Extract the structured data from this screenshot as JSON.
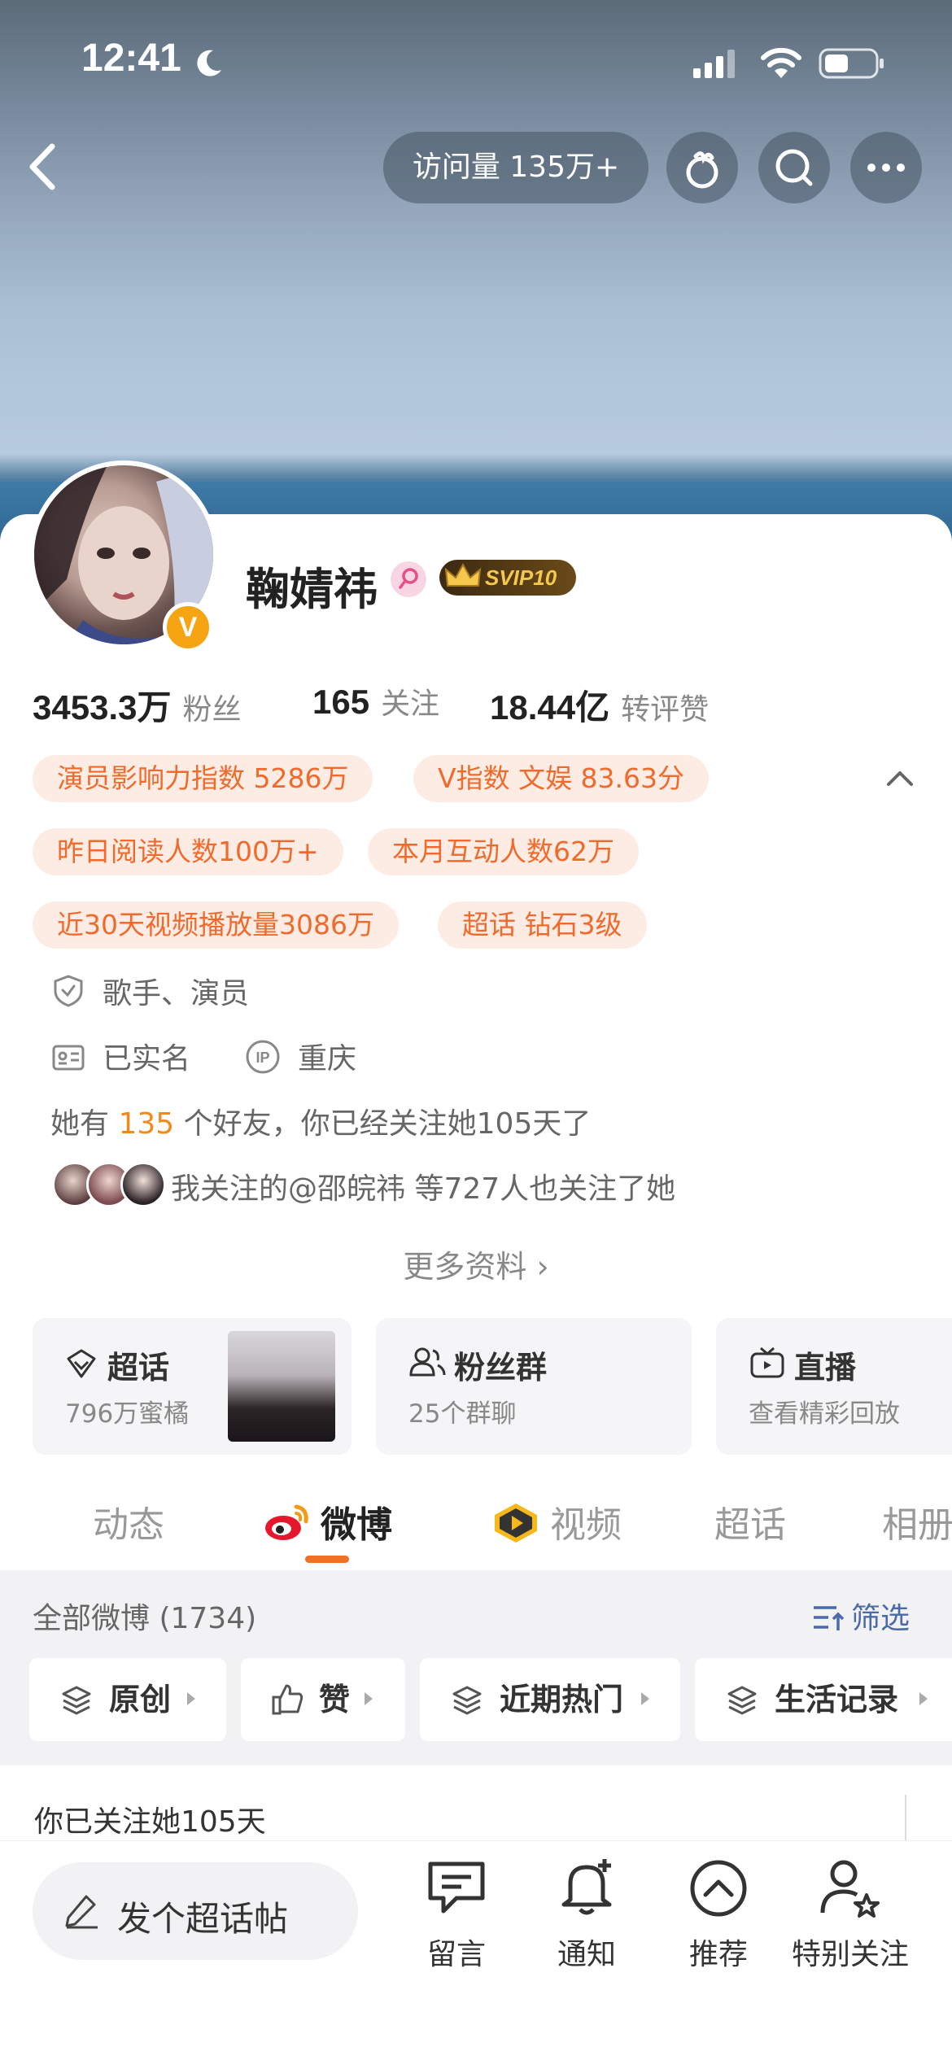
{
  "status_bar": {
    "time": "12:41"
  },
  "header": {
    "visit_count": "访问量 135万+"
  },
  "profile": {
    "name": "鞠婧祎",
    "svip": "SVIP10",
    "verified_badge": "V"
  },
  "stats": [
    {
      "num": "3453.3",
      "unit": "万",
      "label": "粉丝"
    },
    {
      "num": "165",
      "unit": "",
      "label": "关注"
    },
    {
      "num": "18.44",
      "unit": "亿",
      "label": "转评赞"
    }
  ],
  "tags": [
    "演员影响力指数 5286万",
    "V指数 文娱 83.63分",
    "昨日阅读人数100万+",
    "本月互动人数62万",
    "近30天视频播放量3086万",
    "超话 钻石3级"
  ],
  "info": {
    "occupation": "歌手、演员",
    "real_name": "已实名",
    "ip": "重庆",
    "friends_prefix": "她有",
    "friends_count": "135",
    "friends_suffix": "个好友，你已经关注她105天了",
    "mutual": "我关注的@邵皖祎 等727人也关注了她",
    "more": "更多资料 ›"
  },
  "features": [
    {
      "title": "超话",
      "sub": "796万蜜橘"
    },
    {
      "title": "粉丝群",
      "sub": "25个群聊"
    },
    {
      "title": "直播",
      "sub": "查看精彩回放"
    }
  ],
  "tabs": [
    "动态",
    "微博",
    "视频",
    "超话",
    "相册"
  ],
  "feed": {
    "count": "全部微博 (1734)",
    "filter": "筛选",
    "chips": [
      "原创",
      "赞",
      "近期热门",
      "生活记录"
    ],
    "followed_days": "你已关注她105天"
  },
  "bottom": {
    "post": "发个超话帖",
    "actions": [
      "留言",
      "通知",
      "推荐",
      "特别关注"
    ]
  },
  "colors": {
    "accent_orange": "#f07124",
    "tag_bg": "#fdece4",
    "tag_text": "#f06a2c",
    "link_blue": "#4a6aa8"
  }
}
